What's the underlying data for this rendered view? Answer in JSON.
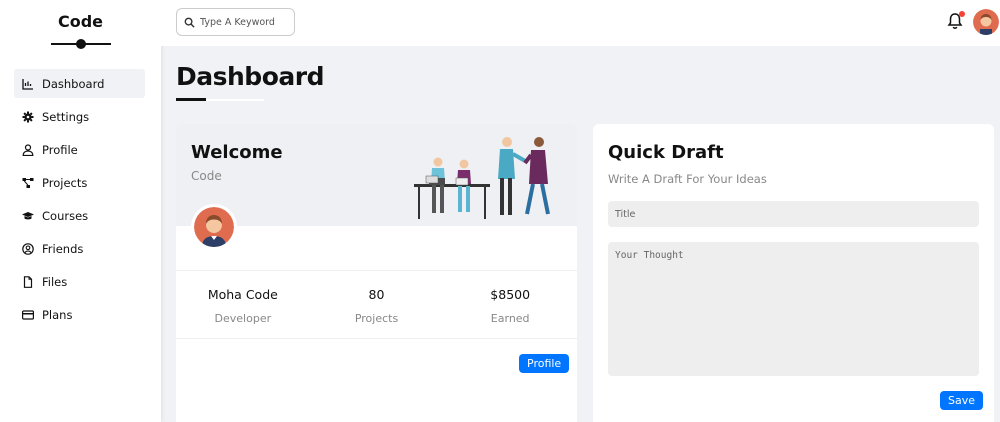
{
  "sidebar": {
    "brand": "Code",
    "items": [
      {
        "label": "Dashboard",
        "icon": "chart-line-icon"
      },
      {
        "label": "Settings",
        "icon": "gear-icon"
      },
      {
        "label": "Profile",
        "icon": "user-icon"
      },
      {
        "label": "Projects",
        "icon": "diagram-project-icon"
      },
      {
        "label": "Courses",
        "icon": "graduation-cap-icon"
      },
      {
        "label": "Friends",
        "icon": "circle-user-icon"
      },
      {
        "label": "Files",
        "icon": "file-icon"
      },
      {
        "label": "Plans",
        "icon": "credit-card-icon"
      }
    ]
  },
  "header": {
    "search_placeholder": "Type A Keyword",
    "notification_color": "#f44336"
  },
  "page": {
    "title": "Dashboard"
  },
  "welcome": {
    "title": "Welcome",
    "subtitle": "Code",
    "stats": [
      {
        "value": "Moha Code",
        "label": "Developer"
      },
      {
        "value": "80",
        "label": "Projects"
      },
      {
        "value": "$8500",
        "label": "Earned"
      }
    ],
    "button_label": "Profile"
  },
  "draft": {
    "title": "Quick Draft",
    "subtitle": "Write A Draft For Your Ideas",
    "title_placeholder": "Title",
    "body_placeholder": "Your Thought",
    "button_label": "Save"
  },
  "colors": {
    "accent": "#0075ff",
    "page_bg": "#f1f2f6"
  }
}
